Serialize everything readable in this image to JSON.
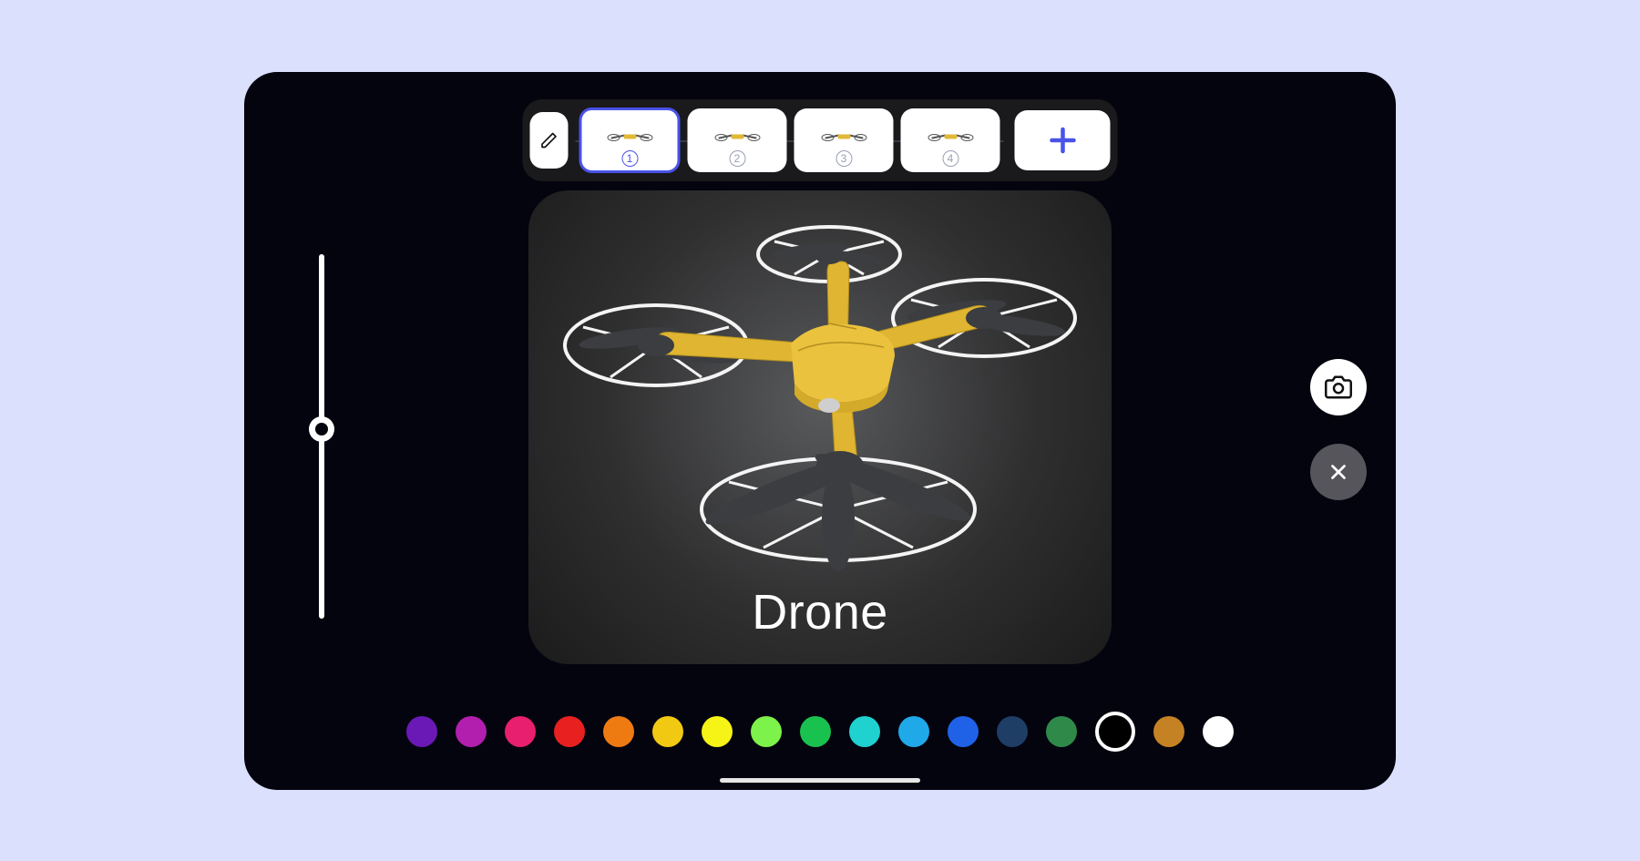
{
  "frames": [
    {
      "index": "1",
      "active": true
    },
    {
      "index": "2",
      "active": false
    },
    {
      "index": "3",
      "active": false
    },
    {
      "index": "4",
      "active": false
    }
  ],
  "icons": {
    "edit": "pencil-icon",
    "add": "plus-icon",
    "camera": "camera-icon",
    "close": "close-icon"
  },
  "slider": {
    "value_percent": 48
  },
  "canvas": {
    "label": "Drone",
    "object": "yellow-quadcopter-drone"
  },
  "colors": [
    {
      "hex": "#6a19b6",
      "selected": false
    },
    {
      "hex": "#b21fae",
      "selected": false
    },
    {
      "hex": "#e81f6f",
      "selected": false
    },
    {
      "hex": "#e82020",
      "selected": false
    },
    {
      "hex": "#ee7a12",
      "selected": false
    },
    {
      "hex": "#f2c912",
      "selected": false
    },
    {
      "hex": "#f6f316",
      "selected": false
    },
    {
      "hex": "#7df24a",
      "selected": false
    },
    {
      "hex": "#19c24e",
      "selected": false
    },
    {
      "hex": "#1fd2d0",
      "selected": false
    },
    {
      "hex": "#20a9e8",
      "selected": false
    },
    {
      "hex": "#1f62e8",
      "selected": false
    },
    {
      "hex": "#1f3e66",
      "selected": false
    },
    {
      "hex": "#2f8a4a",
      "selected": false
    },
    {
      "hex": "#000000",
      "selected": true
    },
    {
      "hex": "#c58225",
      "selected": false
    },
    {
      "hex": "#ffffff",
      "selected": false
    }
  ],
  "accent": "#4a52e8"
}
